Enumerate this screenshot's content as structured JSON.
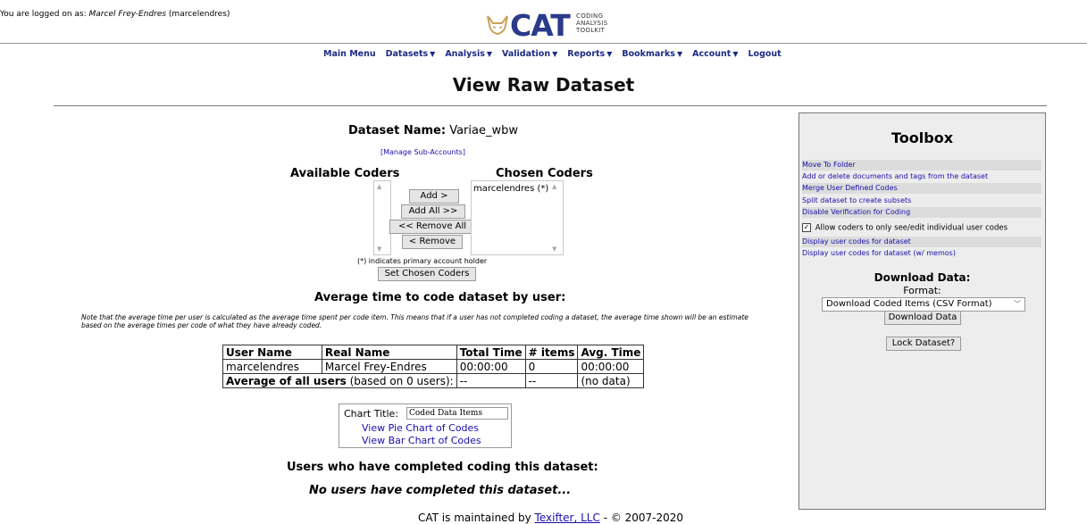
{
  "header": {
    "logged_prefix": "You are logged on as:",
    "user_full": "Marcel Frey-Endres",
    "user_id": "(marcelendres)",
    "logo_text": "CAT",
    "logo_sub": [
      "CODING",
      "ANALYSIS",
      "TOOLKIT"
    ]
  },
  "nav": {
    "items": [
      {
        "label": "Main Menu",
        "caret": false
      },
      {
        "label": "Datasets",
        "caret": true
      },
      {
        "label": "Analysis",
        "caret": true
      },
      {
        "label": "Validation",
        "caret": true
      },
      {
        "label": "Reports",
        "caret": true
      },
      {
        "label": "Bookmarks",
        "caret": true
      },
      {
        "label": "Account",
        "caret": true
      },
      {
        "label": "Logout",
        "caret": false
      }
    ]
  },
  "page_title": "View Raw Dataset",
  "dataset": {
    "name_label": "Dataset Name:",
    "name_value": "Variae_wbw",
    "manage_link": "[Manage Sub-Accounts]"
  },
  "coders": {
    "available_label": "Available Coders",
    "chosen_label": "Chosen Coders",
    "chosen_items": [
      "marcelendres (*)"
    ],
    "add": "Add >",
    "add_all": "Add All >>",
    "remove_all": "<< Remove All",
    "remove": "< Remove",
    "primary_note": "(*) indicates primary account holder",
    "set_chosen": "Set Chosen Coders"
  },
  "avg": {
    "heading": "Average time to code dataset by user:",
    "note": "Note that the average time per user is calculated as the average time spent per code item. This means that if a user has not completed coding a dataset, the average time shown will be an estimate based on the average times per code of what they have already coded.",
    "columns": [
      "User Name",
      "Real Name",
      "Total Time",
      "# items",
      "Avg. Time"
    ],
    "rows": [
      [
        "marcelendres",
        "Marcel Frey-Endres",
        "00:00:00",
        "0",
        "00:00:00"
      ]
    ],
    "summary_bold": "Average of all users",
    "summary_rest": " (based on 0 users):",
    "summary_total": "--",
    "summary_items": "--",
    "summary_avg": "(no data)"
  },
  "chart_box": {
    "title_label": "Chart Title:",
    "title_value": "Coded Data Items",
    "pie_link": "View Pie Chart of Codes",
    "bar_link": "View Bar Chart of Codes"
  },
  "completed": {
    "heading": "Users who have completed coding this dataset:",
    "none_text": "No users have completed this dataset..."
  },
  "footer": {
    "prefix": "CAT is maintained by",
    "link": "Texifter, LLC",
    "suffix": "- © 2007-2020"
  },
  "toolbox": {
    "title": "Toolbox",
    "links": [
      "Move To Folder",
      "Add or delete documents and tags from the dataset",
      "Merge User Defined Codes",
      "Split dataset to create subsets",
      "Disable Verification for Coding"
    ],
    "checkbox_label": "Allow coders to only see/edit individual user codes",
    "checkbox_checked": true,
    "links2": [
      "Display user codes for dataset",
      "Display user codes for dataset (w/ memos)"
    ],
    "download_heading": "Download Data:",
    "format_label": "Format:",
    "format_value": "Download Coded Items (CSV Format)",
    "download_button": "Download Data",
    "lock_button": "Lock Dataset?"
  }
}
